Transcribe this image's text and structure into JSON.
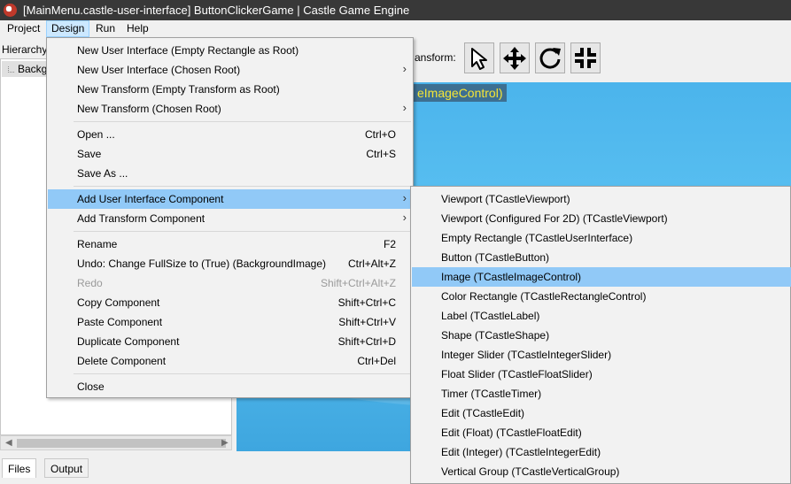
{
  "window": {
    "title": "[MainMenu.castle-user-interface] ButtonClickerGame | Castle Game Engine"
  },
  "menubar": [
    "Project",
    "Design",
    "Run",
    "Help"
  ],
  "left_panel": {
    "hierarchy_label": "Hierarchy",
    "tree_item": "Backg"
  },
  "bottom_tabs": [
    "Files",
    "Output"
  ],
  "toolbar": {
    "transform_label": "ansform:",
    "tools": [
      "select-tool",
      "translate-tool",
      "rotate-tool",
      "scale-tool"
    ]
  },
  "viewport": {
    "selected_label": "eImageControl)",
    "background": "#4bb4ec"
  },
  "design_menu": {
    "items": [
      {
        "label": "New User Interface (Empty Rectangle as Root)",
        "shortcut": "",
        "submenu": false
      },
      {
        "label": "New User Interface (Chosen Root)",
        "shortcut": "",
        "submenu": true
      },
      {
        "label": "New Transform (Empty Transform as Root)",
        "shortcut": "",
        "submenu": false
      },
      {
        "label": "New Transform (Chosen Root)",
        "shortcut": "",
        "submenu": true
      },
      {
        "label": "Open ...",
        "shortcut": "Ctrl+O",
        "submenu": false
      },
      {
        "label": "Save",
        "shortcut": "Ctrl+S",
        "submenu": false
      },
      {
        "label": "Save As ...",
        "shortcut": "",
        "submenu": false
      },
      {
        "label": "Add User Interface Component",
        "shortcut": "",
        "submenu": true,
        "highlighted": true
      },
      {
        "label": "Add Transform Component",
        "shortcut": "",
        "submenu": true
      },
      {
        "label": "Rename",
        "shortcut": "F2",
        "submenu": false
      },
      {
        "label": "Undo: Change FullSize to (True) (BackgroundImage)",
        "shortcut": "Ctrl+Alt+Z",
        "submenu": false
      },
      {
        "label": "Redo",
        "shortcut": "Shift+Ctrl+Alt+Z",
        "submenu": false,
        "disabled": true
      },
      {
        "label": "Copy Component",
        "shortcut": "Shift+Ctrl+C",
        "submenu": false
      },
      {
        "label": "Paste Component",
        "shortcut": "Shift+Ctrl+V",
        "submenu": false
      },
      {
        "label": "Duplicate Component",
        "shortcut": "Shift+Ctrl+D",
        "submenu": false
      },
      {
        "label": "Delete Component",
        "shortcut": "Ctrl+Del",
        "submenu": false
      },
      {
        "label": "Close",
        "shortcut": "",
        "submenu": false
      }
    ]
  },
  "submenu": {
    "items": [
      "Viewport (TCastleViewport)",
      "Viewport (Configured For 2D) (TCastleViewport)",
      "Empty Rectangle (TCastleUserInterface)",
      "Button (TCastleButton)",
      "Image (TCastleImageControl)",
      "Color Rectangle (TCastleRectangleControl)",
      "Label (TCastleLabel)",
      "Shape (TCastleShape)",
      "Integer Slider (TCastleIntegerSlider)",
      "Float Slider (TCastleFloatSlider)",
      "Timer (TCastleTimer)",
      "Edit (TCastleEdit)",
      "Edit (Float) (TCastleFloatEdit)",
      "Edit (Integer) (TCastleIntegerEdit)",
      "Vertical Group (TCastleVerticalGroup)"
    ],
    "highlighted_index": 4
  }
}
